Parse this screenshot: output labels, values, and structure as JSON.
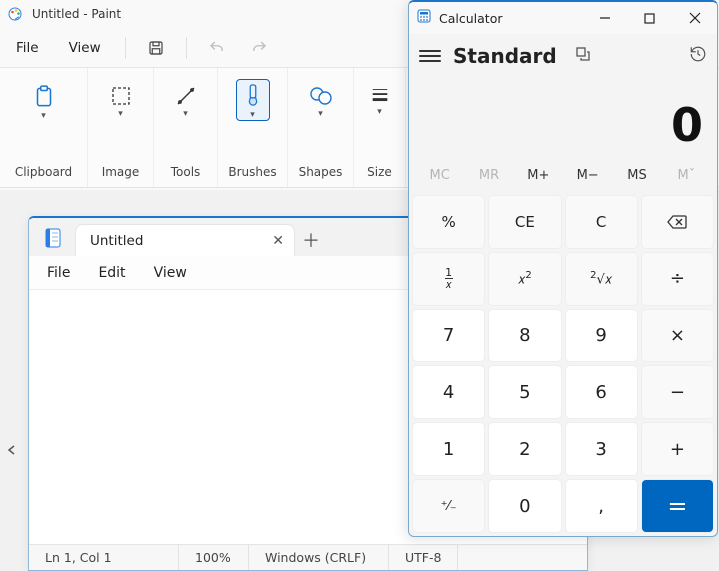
{
  "paint": {
    "title": "Untitled - Paint",
    "menu": {
      "file": "File",
      "view": "View"
    },
    "toolbar": {
      "save": "save",
      "undo": "undo",
      "redo": "redo"
    },
    "ribbon": {
      "clipboard": "Clipboard",
      "image": "Image",
      "tools": "Tools",
      "brushes": "Brushes",
      "shapes": "Shapes",
      "size": "Size"
    }
  },
  "notepad": {
    "tab_title": "Untitled",
    "menu": {
      "file": "File",
      "edit": "Edit",
      "view": "View"
    },
    "status": {
      "pos": "Ln 1, Col 1",
      "zoom": "100%",
      "line_ending": "Windows (CRLF)",
      "encoding": "UTF-8"
    }
  },
  "calc": {
    "title": "Calculator",
    "mode": "Standard",
    "display": "0",
    "memory": {
      "mc": "MC",
      "mr": "MR",
      "mplus": "M+",
      "mminus": "M−",
      "ms": "MS",
      "mlist": "Mˇ"
    },
    "keys": {
      "percent": "%",
      "ce": "CE",
      "c": "C",
      "back": "⌫",
      "recip": "¹⁄ₓ",
      "square": "x²",
      "sqrt": "²√x",
      "div": "÷",
      "k7": "7",
      "k8": "8",
      "k9": "9",
      "mul": "×",
      "k4": "4",
      "k5": "5",
      "k6": "6",
      "sub": "−",
      "k1": "1",
      "k2": "2",
      "k3": "3",
      "add": "+",
      "neg": "⁺⁄₋",
      "k0": "0",
      "dec": ",",
      "eq": "="
    }
  }
}
